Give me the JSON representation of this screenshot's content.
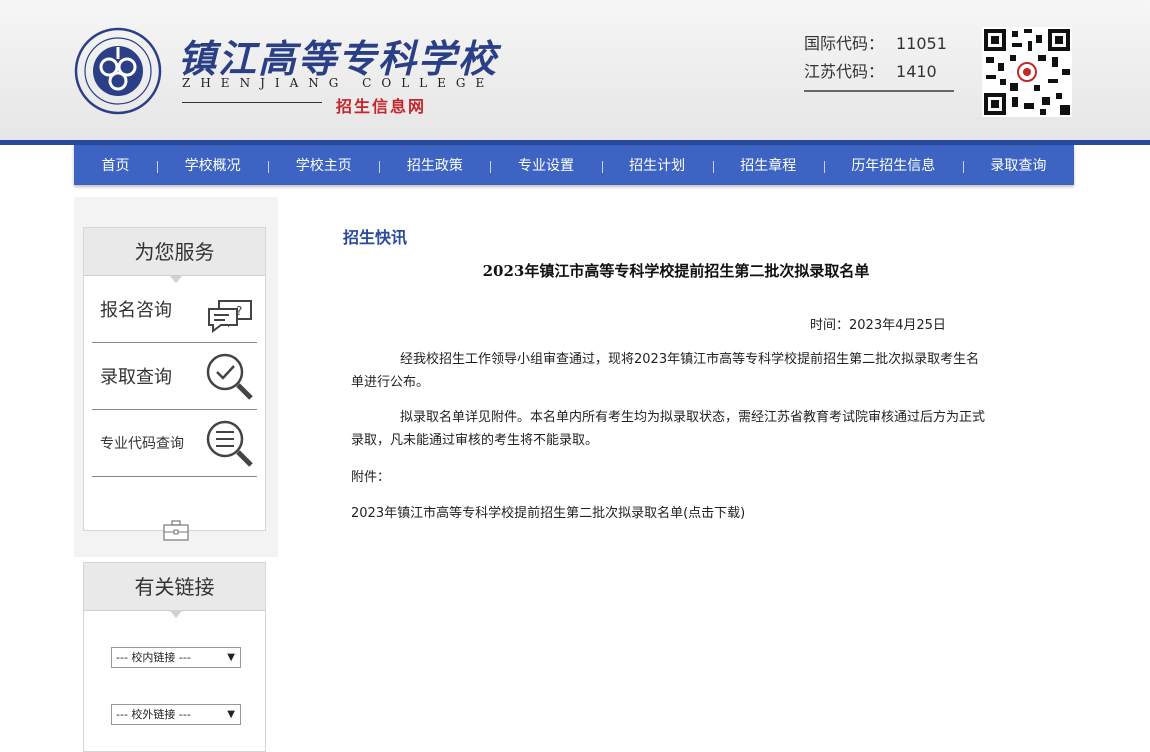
{
  "header": {
    "school_name": "镇江高等专科学校",
    "school_en": "ZHENJIANG COLLEGE",
    "sub_title": "招生信息网",
    "codes": [
      {
        "label": "国际代码：",
        "value": "11051"
      },
      {
        "label": "江苏代码：",
        "value": "1410"
      }
    ]
  },
  "nav": [
    "首页",
    "学校概况",
    "学校主页",
    "招生政策",
    "专业设置",
    "招生计划",
    "招生章程",
    "历年招生信息",
    "录取查询"
  ],
  "sidebar": {
    "service_title": "为您服务",
    "services": [
      "报名咨询",
      "录取查询",
      "专业代码查询"
    ],
    "links_title": "有关链接",
    "internal_select": "--- 校内链接 ---",
    "external_select": "--- 校外链接 ---"
  },
  "article": {
    "section": "招生快讯",
    "title": "2023年镇江市高等专科学校提前招生第二批次拟录取名单",
    "date": "时间：2023年4月25日",
    "para1": "经我校招生工作领导小组审查通过，现将2023年镇江市高等专科学校提前招生第二批次拟录取考生名单进行公布。",
    "para2": "拟录取名单详见附件。本名单内所有考生均为拟录取状态，需经江苏省教育考试院审核通过后方为正式录取，凡未能通过审核的考生将不能录取。",
    "attachment_label": "附件：",
    "attachment_link": "2023年镇江市高等专科学校提前招生第二批次拟录取名单(点击下载)"
  },
  "colors": {
    "nav_bg": "#3d64c2",
    "brand_blue": "#2b4a9c",
    "accent_red": "#c6262a"
  }
}
